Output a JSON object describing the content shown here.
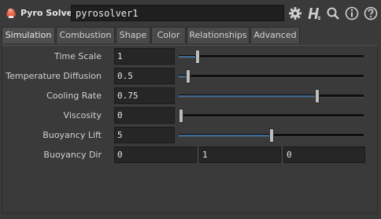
{
  "header": {
    "node_type": "Pyro Solver",
    "node_name": "pyrosolver1",
    "icons": [
      "gear-icon",
      "houdini-h-icon",
      "search-icon",
      "info-icon",
      "help-icon"
    ],
    "icon_color": "#cfcfcf",
    "node_icon_color": "#d9533d"
  },
  "tabs": [
    {
      "label": "Simulation",
      "active": true
    },
    {
      "label": "Combustion",
      "active": false
    },
    {
      "label": "Shape",
      "active": false
    },
    {
      "label": "Color",
      "active": false
    },
    {
      "label": "Relationships",
      "active": false
    },
    {
      "label": "Advanced",
      "active": false
    }
  ],
  "params": {
    "time_scale": {
      "label": "Time Scale",
      "value": "1",
      "slider_fraction": 0.1
    },
    "temperature_diffusion": {
      "label": "Temperature Diffusion",
      "value": "0.5",
      "slider_fraction": 0.05
    },
    "cooling_rate": {
      "label": "Cooling Rate",
      "value": "0.75",
      "slider_fraction": 0.75
    },
    "viscosity": {
      "label": "Viscosity",
      "value": "0",
      "slider_fraction": 0.0
    },
    "buoyancy_lift": {
      "label": "Buoyancy Lift",
      "value": "5",
      "slider_fraction": 0.5
    },
    "buoyancy_dir": {
      "label": "Buoyancy Dir",
      "x": "0",
      "y": "1",
      "z": "0"
    }
  },
  "colors": {
    "slider_fill": "#3f6a93",
    "background": "#3a3a3a",
    "field_bg": "#262626"
  }
}
